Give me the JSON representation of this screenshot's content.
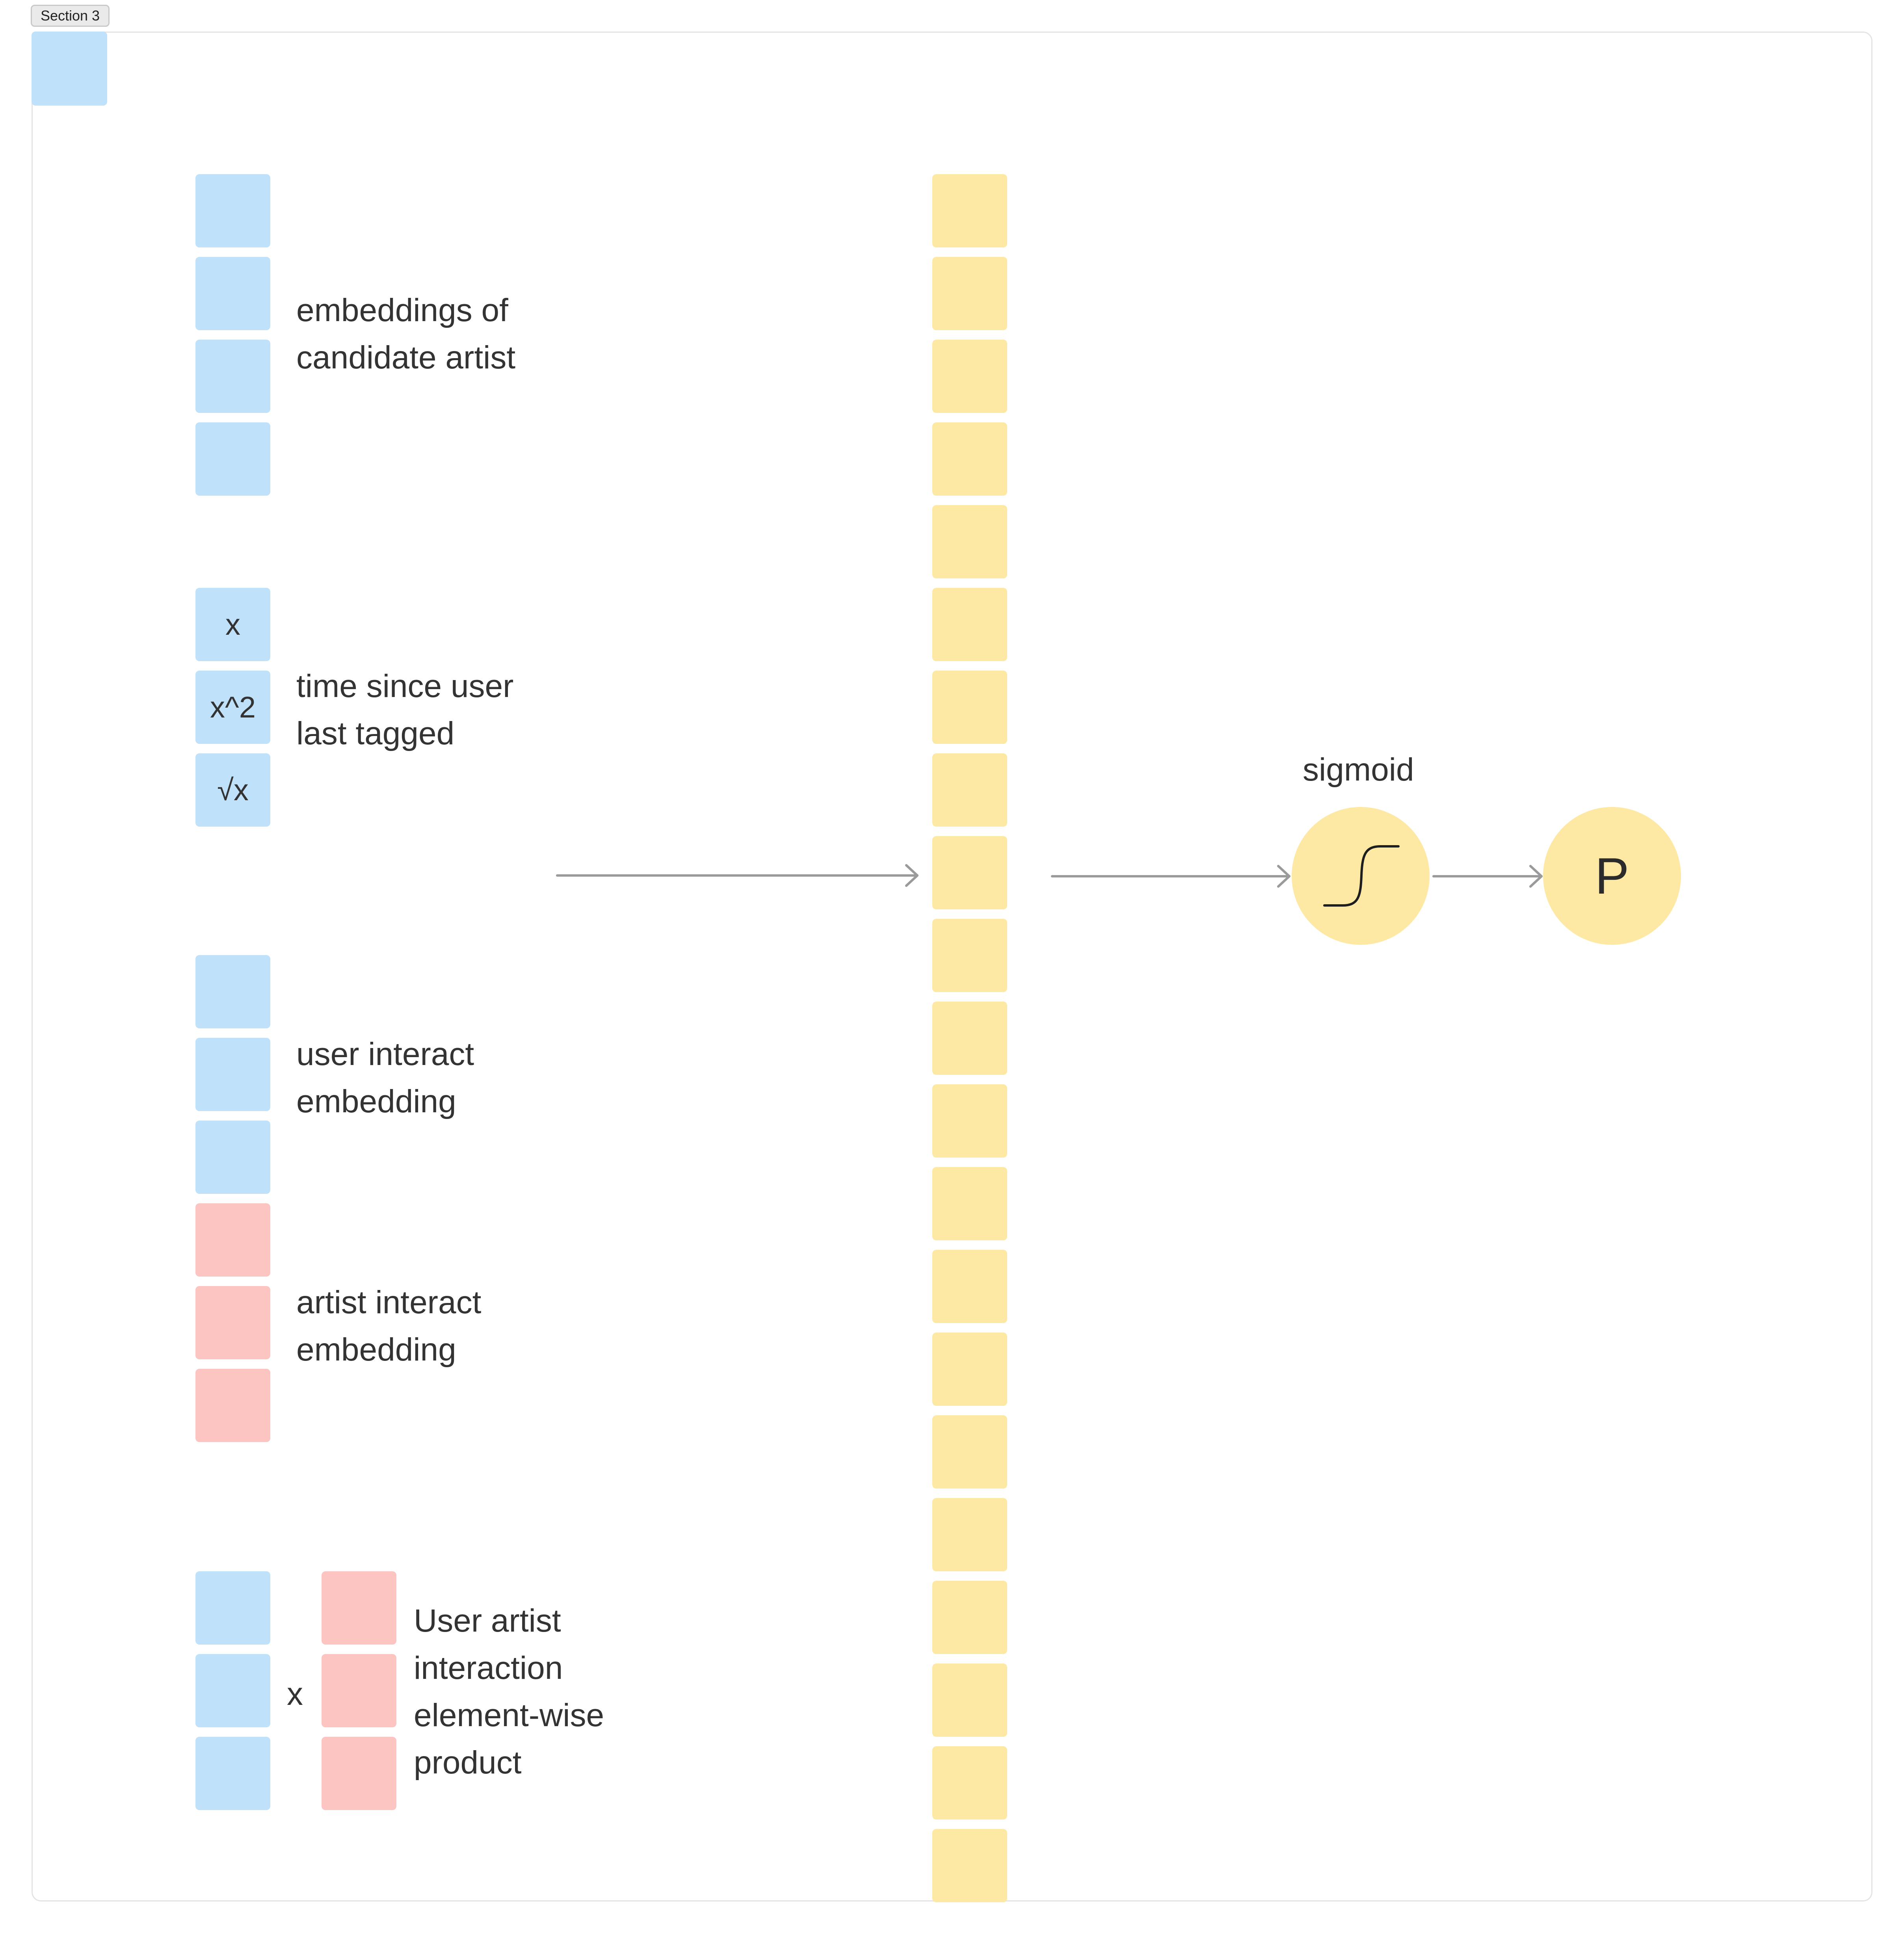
{
  "section": {
    "title": "Section 3"
  },
  "inputs": {
    "candidate_artist": {
      "lines": [
        "embeddings of",
        "candidate artist"
      ]
    },
    "time_since": {
      "lines": [
        "time since user",
        "last tagged"
      ],
      "features": [
        "x",
        "x^2",
        "√x"
      ]
    },
    "user_interact": {
      "lines": [
        "user interact",
        "embedding"
      ]
    },
    "artist_interact": {
      "lines": [
        "artist interact",
        "embedding"
      ]
    },
    "product": {
      "operator": "x",
      "lines": [
        "User artist",
        "interaction",
        "element-wise",
        "product"
      ]
    }
  },
  "activation": {
    "label": "sigmoid"
  },
  "output": {
    "label": "P"
  },
  "colors": {
    "user_feature": "#bfe2fa",
    "artist_feature": "#fdc5c1",
    "hidden_layer": "#fde8a4",
    "arrow": "#9a9a9a"
  }
}
